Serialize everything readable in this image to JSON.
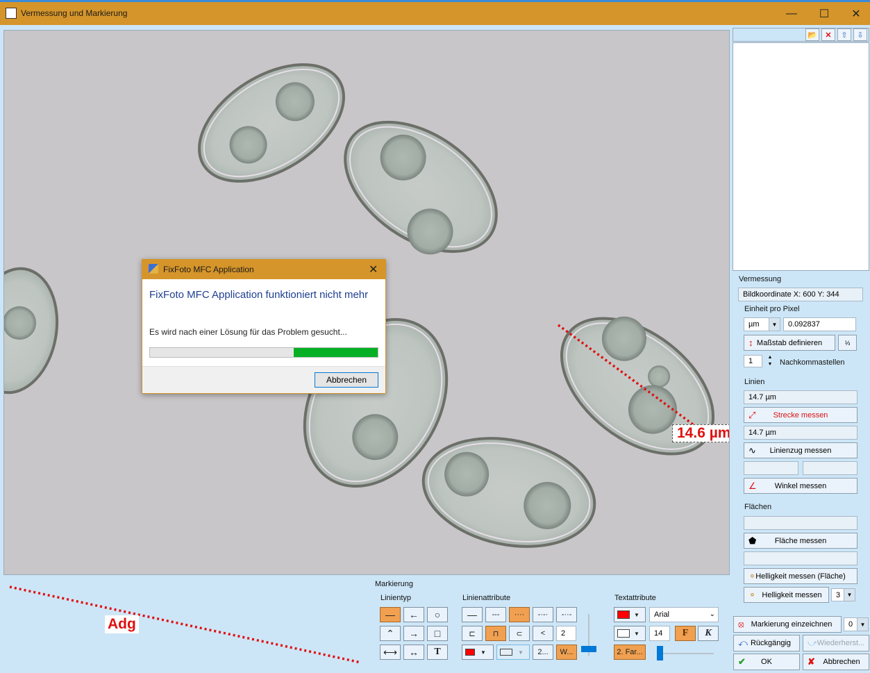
{
  "window": {
    "title": "Vermessung und Markierung",
    "minimize": "—",
    "maximize": "☐",
    "close": "✕"
  },
  "image": {
    "measurement_label": "14.6 µm",
    "annotation_label": "Adg"
  },
  "dialog": {
    "title": "FixFoto MFC Application",
    "heading": "FixFoto MFC Application funktioniert nicht mehr",
    "message": "Es wird nach einer Lösung für das Problem gesucht...",
    "progress": 0.37,
    "button": "Abbrechen",
    "close": "✕"
  },
  "vermessung": {
    "section_label": "Vermessung",
    "coordinates": "Bildkoordinate X: 600 Y: 344",
    "unit_label": "Einheit pro Pixel",
    "unit": "µm",
    "unit_value": "0.092837",
    "scale_button": "Maßstab definieren",
    "decimals_value": "1",
    "decimals_label": "Nachkommastellen"
  },
  "linien": {
    "section_label": "Linien",
    "line_value": "14.7 µm",
    "line_button": "Strecke messen",
    "polyline_value": "14.7 µm",
    "polyline_button": "Linienzug messen",
    "angle_button": "Winkel messen"
  },
  "flaechen": {
    "section_label": "Flächen",
    "area_button": "Fläche messen",
    "brightness_area_button": "Helligkeit messen (Fläche)",
    "brightness_button": "Helligkeit messen",
    "brightness_size": "3"
  },
  "actions": {
    "draw_marking": "Markierung einzeichnen",
    "draw_marking_value": "0",
    "undo": "Rückgängig",
    "redo": "Wiederherst...",
    "ok": "OK",
    "cancel": "Abbrechen"
  },
  "markierung": {
    "section_label": "Markierung",
    "linetype_label": "Linientyp",
    "lineattr_label": "Linienattribute",
    "textattr_label": "Textattribute",
    "line_width": "2",
    "two_btn": "2...",
    "w_btn": "W...",
    "font": "Arial",
    "font_size": "14",
    "bold": "F",
    "italic": "K",
    "two_colors": "2. Far..."
  },
  "colors": {
    "titlebar": "#d5952a",
    "accent_blue": "#3b8bd8",
    "panel": "#cde6f7",
    "measure_red": "#e01010",
    "progress_green": "#06b025",
    "toggle_on": "#f0a050"
  }
}
